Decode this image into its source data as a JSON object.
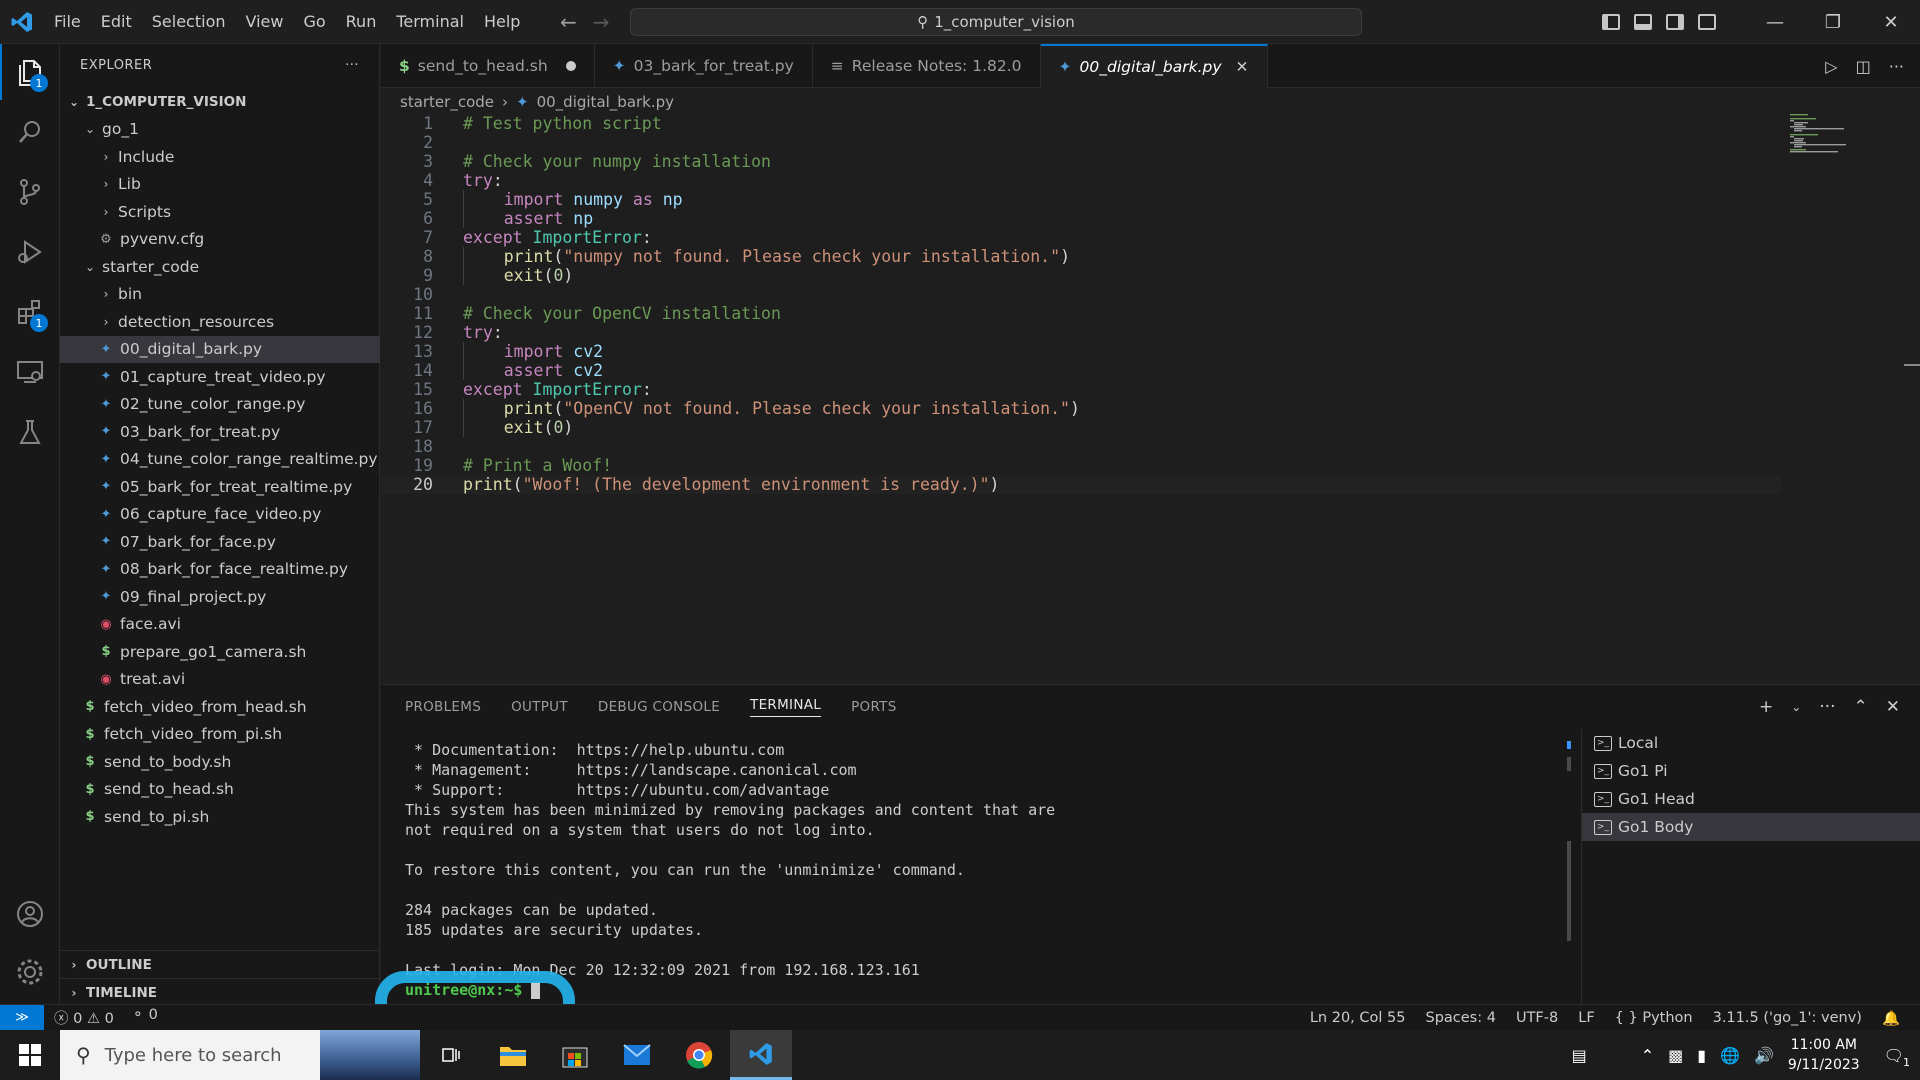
{
  "menu": [
    "File",
    "Edit",
    "Selection",
    "View",
    "Go",
    "Run",
    "Terminal",
    "Help"
  ],
  "command_center": "1_computer_vision",
  "activity_badges": {
    "explorer": "1",
    "extensions": "1"
  },
  "explorer": {
    "header": "EXPLORER",
    "root": "1_COMPUTER_VISION",
    "items": [
      {
        "label": "go_1",
        "depth": 1,
        "type": "folder-open"
      },
      {
        "label": "Include",
        "depth": 2,
        "type": "folder"
      },
      {
        "label": "Lib",
        "depth": 2,
        "type": "folder"
      },
      {
        "label": "Scripts",
        "depth": 2,
        "type": "folder"
      },
      {
        "label": "pyvenv.cfg",
        "depth": 2,
        "type": "cfg"
      },
      {
        "label": "starter_code",
        "depth": 1,
        "type": "folder-open"
      },
      {
        "label": "bin",
        "depth": 2,
        "type": "folder"
      },
      {
        "label": "detection_resources",
        "depth": 2,
        "type": "folder"
      },
      {
        "label": "00_digital_bark.py",
        "depth": 2,
        "type": "py",
        "selected": true
      },
      {
        "label": "01_capture_treat_video.py",
        "depth": 2,
        "type": "py"
      },
      {
        "label": "02_tune_color_range.py",
        "depth": 2,
        "type": "py"
      },
      {
        "label": "03_bark_for_treat.py",
        "depth": 2,
        "type": "py"
      },
      {
        "label": "04_tune_color_range_realtime.py",
        "depth": 2,
        "type": "py"
      },
      {
        "label": "05_bark_for_treat_realtime.py",
        "depth": 2,
        "type": "py"
      },
      {
        "label": "06_capture_face_video.py",
        "depth": 2,
        "type": "py"
      },
      {
        "label": "07_bark_for_face.py",
        "depth": 2,
        "type": "py"
      },
      {
        "label": "08_bark_for_face_realtime.py",
        "depth": 2,
        "type": "py"
      },
      {
        "label": "09_final_project.py",
        "depth": 2,
        "type": "py"
      },
      {
        "label": "face.avi",
        "depth": 2,
        "type": "avi"
      },
      {
        "label": "prepare_go1_camera.sh",
        "depth": 2,
        "type": "sh"
      },
      {
        "label": "treat.avi",
        "depth": 2,
        "type": "avi"
      },
      {
        "label": "fetch_video_from_head.sh",
        "depth": 1,
        "type": "sh"
      },
      {
        "label": "fetch_video_from_pi.sh",
        "depth": 1,
        "type": "sh"
      },
      {
        "label": "send_to_body.sh",
        "depth": 1,
        "type": "sh"
      },
      {
        "label": "send_to_head.sh",
        "depth": 1,
        "type": "sh"
      },
      {
        "label": "send_to_pi.sh",
        "depth": 1,
        "type": "sh"
      }
    ],
    "outline": "OUTLINE",
    "timeline": "TIMELINE"
  },
  "tabs": [
    {
      "label": "send_to_head.sh",
      "icon": "$",
      "modified": true
    },
    {
      "label": "03_bark_for_treat.py",
      "icon": "py"
    },
    {
      "label": "Release Notes: 1.82.0",
      "icon": "doc"
    },
    {
      "label": "00_digital_bark.py",
      "icon": "py",
      "active": true
    }
  ],
  "breadcrumb": [
    "starter_code",
    "00_digital_bark.py"
  ],
  "code": [
    "# Test python script",
    "",
    "# Check your numpy installation",
    "try:",
    "    import numpy as np",
    "    assert np",
    "except ImportError:",
    "    print(\"numpy not found. Please check your installation.\")",
    "    exit(0)",
    "",
    "# Check your OpenCV installation",
    "try:",
    "    import cv2",
    "    assert cv2",
    "except ImportError:",
    "    print(\"OpenCV not found. Please check your installation.\")",
    "    exit(0)",
    "",
    "# Print a Woof!",
    "print(\"Woof! (The development environment is ready.)\")"
  ],
  "current_line": 20,
  "panel": {
    "tabs": [
      "PROBLEMS",
      "OUTPUT",
      "DEBUG CONSOLE",
      "TERMINAL",
      "PORTS"
    ],
    "active_tab": "TERMINAL",
    "terminal_lines": [
      " * Documentation:  https://help.ubuntu.com",
      " * Management:     https://landscape.canonical.com",
      " * Support:        https://ubuntu.com/advantage",
      "This system has been minimized by removing packages and content that are",
      "not required on a system that users do not log into.",
      "",
      "To restore this content, you can run the 'unminimize' command.",
      "",
      "284 packages can be updated.",
      "185 updates are security updates.",
      "",
      "Last login: Mon Dec 20 12:32:09 2021 from 192.168.123.161"
    ],
    "prompt": "unitree@nx:~$ ",
    "terminals": [
      "Local",
      "Go1 Pi",
      "Go1 Head",
      "Go1 Body"
    ],
    "active_terminal": "Go1 Body"
  },
  "status": {
    "errors": "0",
    "warnings": "0",
    "ports": "0",
    "position": "Ln 20, Col 55",
    "spaces": "Spaces: 4",
    "encoding": "UTF-8",
    "eol": "LF",
    "language": "Python",
    "interpreter": "3.11.5 ('go_1': venv)"
  },
  "taskbar": {
    "search_placeholder": "Type here to search",
    "time": "11:00 AM",
    "date": "9/11/2023",
    "notif_count": "1"
  },
  "colors": {
    "accent": "#0078d4",
    "background": "#1e1e1e",
    "highlight_mark": "#24b6ef"
  }
}
